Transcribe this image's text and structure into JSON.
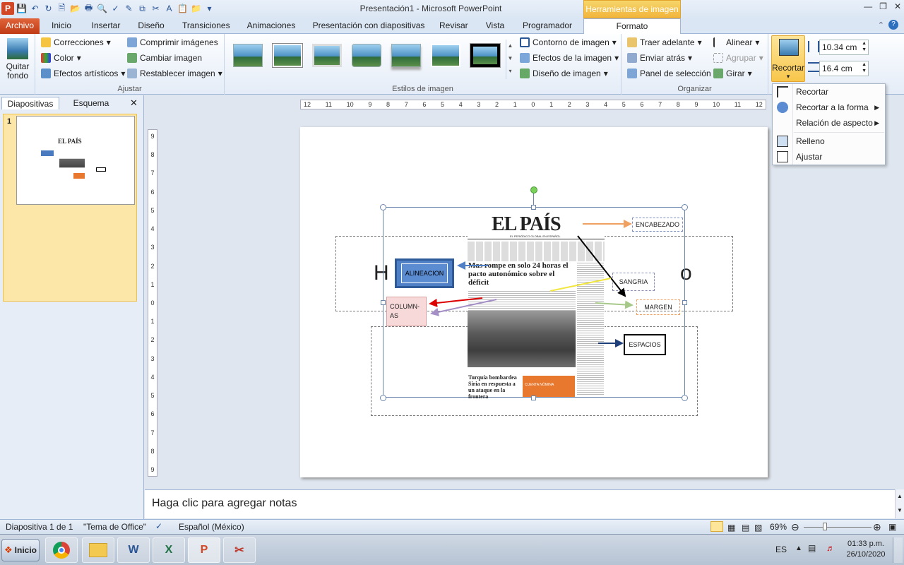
{
  "window": {
    "title": "Presentación1 - Microsoft PowerPoint",
    "context_tab": "Herramientas de imagen"
  },
  "tabs": [
    "Archivo",
    "Inicio",
    "Insertar",
    "Diseño",
    "Transiciones",
    "Animaciones",
    "Presentación con diapositivas",
    "Revisar",
    "Vista",
    "Programador",
    "Formato"
  ],
  "ribbon": {
    "quitar_fondo": "Quitar fondo",
    "ajustar": {
      "label": "Ajustar",
      "correcciones": "Correcciones",
      "color": "Color",
      "efectos": "Efectos artísticos",
      "comprimir": "Comprimir imágenes",
      "cambiar": "Cambiar imagen",
      "restablecer": "Restablecer imagen"
    },
    "estilos": {
      "label": "Estilos de imagen",
      "contorno": "Contorno de imagen",
      "efectos": "Efectos de la imagen",
      "diseno": "Diseño de imagen"
    },
    "organizar": {
      "label": "Organizar",
      "traer": "Traer adelante",
      "enviar": "Enviar atrás",
      "panel": "Panel de selección",
      "alinear": "Alinear",
      "agrupar": "Agrupar",
      "girar": "Girar"
    },
    "tamano": {
      "recortar": "Recortar",
      "height": "10.34 cm",
      "width": "16.4 cm"
    }
  },
  "crop_menu": [
    "Recortar",
    "Recortar a la forma",
    "Relación de aspecto",
    "Relleno",
    "Ajustar"
  ],
  "side": {
    "tab_slides": "Diapositivas",
    "tab_outline": "Esquema",
    "slide_number": "1"
  },
  "ruler_h": [
    "12",
    "11",
    "10",
    "9",
    "8",
    "7",
    "6",
    "5",
    "4",
    "3",
    "2",
    "1",
    "0",
    "1",
    "2",
    "3",
    "4",
    "5",
    "6",
    "7",
    "8",
    "9",
    "10",
    "11",
    "12"
  ],
  "ruler_v": [
    "9",
    "8",
    "7",
    "6",
    "5",
    "4",
    "3",
    "2",
    "1",
    "0",
    "1",
    "2",
    "3",
    "4",
    "5",
    "6",
    "7",
    "8",
    "9"
  ],
  "slide": {
    "title_partial_left": "H",
    "title_partial_right": "o",
    "newspaper": {
      "masthead": "EL PAÍS",
      "tagline": "EL PERIÓDICO GLOBAL EN ESPAÑOL",
      "headline": "Mas rompe en solo 24 horas el pacto autonómico sobre el déficit",
      "sub_headline": "Turquía bombardea Siria en respuesta a un ataque en la frontera",
      "orange_box": "CUENTA NÓMINA"
    },
    "labels": {
      "encabezado": "ENCABEZADO",
      "alineacion": "ALINEACION",
      "sangria": "SANGRIA",
      "columnas": "COLUMN-AS",
      "margen": "MARGEN",
      "espacios": "ESPACIOS"
    }
  },
  "notes_placeholder": "Haga clic para agregar notas",
  "status": {
    "slide": "Diapositiva 1 de 1",
    "theme": "\"Tema de Office\"",
    "language": "Español (México)",
    "zoom": "69%"
  },
  "taskbar": {
    "start": "Inicio",
    "lang": "ES",
    "time": "01:33 p.m.",
    "date": "26/10/2020"
  }
}
